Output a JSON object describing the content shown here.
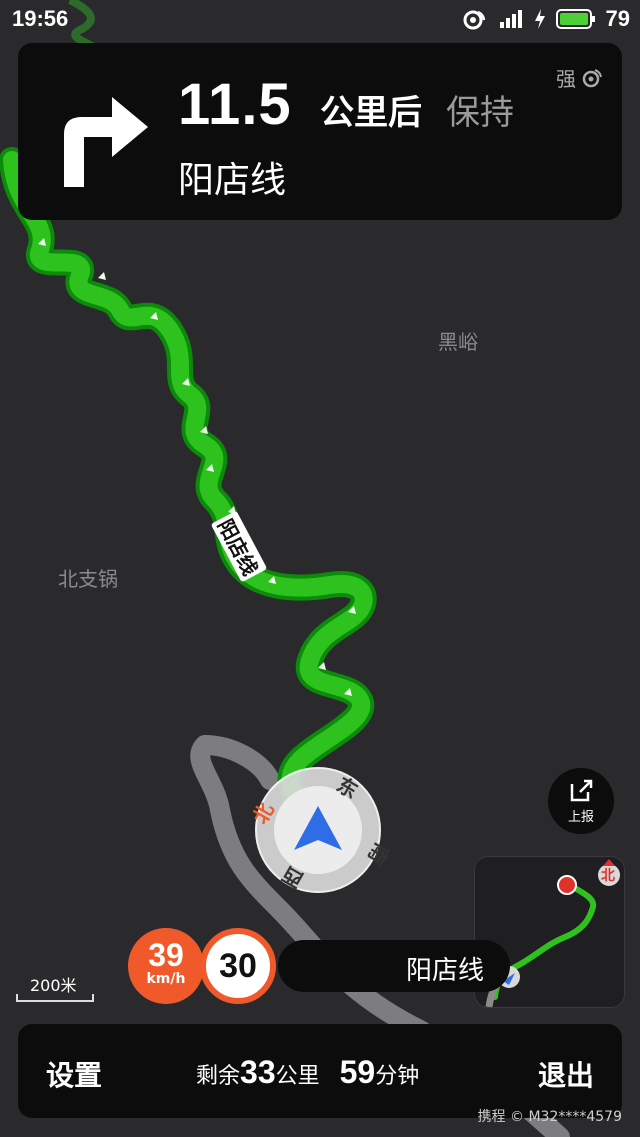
{
  "status_bar": {
    "time": "19:56",
    "battery": "79"
  },
  "maneuver": {
    "distance": "11.5",
    "unit": "公里后",
    "action": "保持",
    "road": "阳店线",
    "signal": "强"
  },
  "map_labels": {
    "place1": "黑峪",
    "place2": "北支锅",
    "road": "阳店线"
  },
  "compass": {
    "north": "北",
    "east": "东",
    "south": "南",
    "west": "西"
  },
  "report": {
    "label": "上报"
  },
  "minimap": {
    "north": "北"
  },
  "speed": {
    "current": "39",
    "unit": "km/h",
    "limit": "30",
    "road": "阳店线"
  },
  "scale": {
    "label": "200米"
  },
  "bottom": {
    "settings": "设置",
    "remain_prefix": "剩余",
    "remain_distance": "33",
    "remain_distance_unit": "公里",
    "remain_time": "59",
    "remain_time_unit": "分钟",
    "exit": "退出"
  },
  "watermark": "携程 © M32****4579",
  "colors": {
    "route": "#2ec21f",
    "speed_badge": "#f0592a",
    "card_bg": "#0c0c0c"
  }
}
